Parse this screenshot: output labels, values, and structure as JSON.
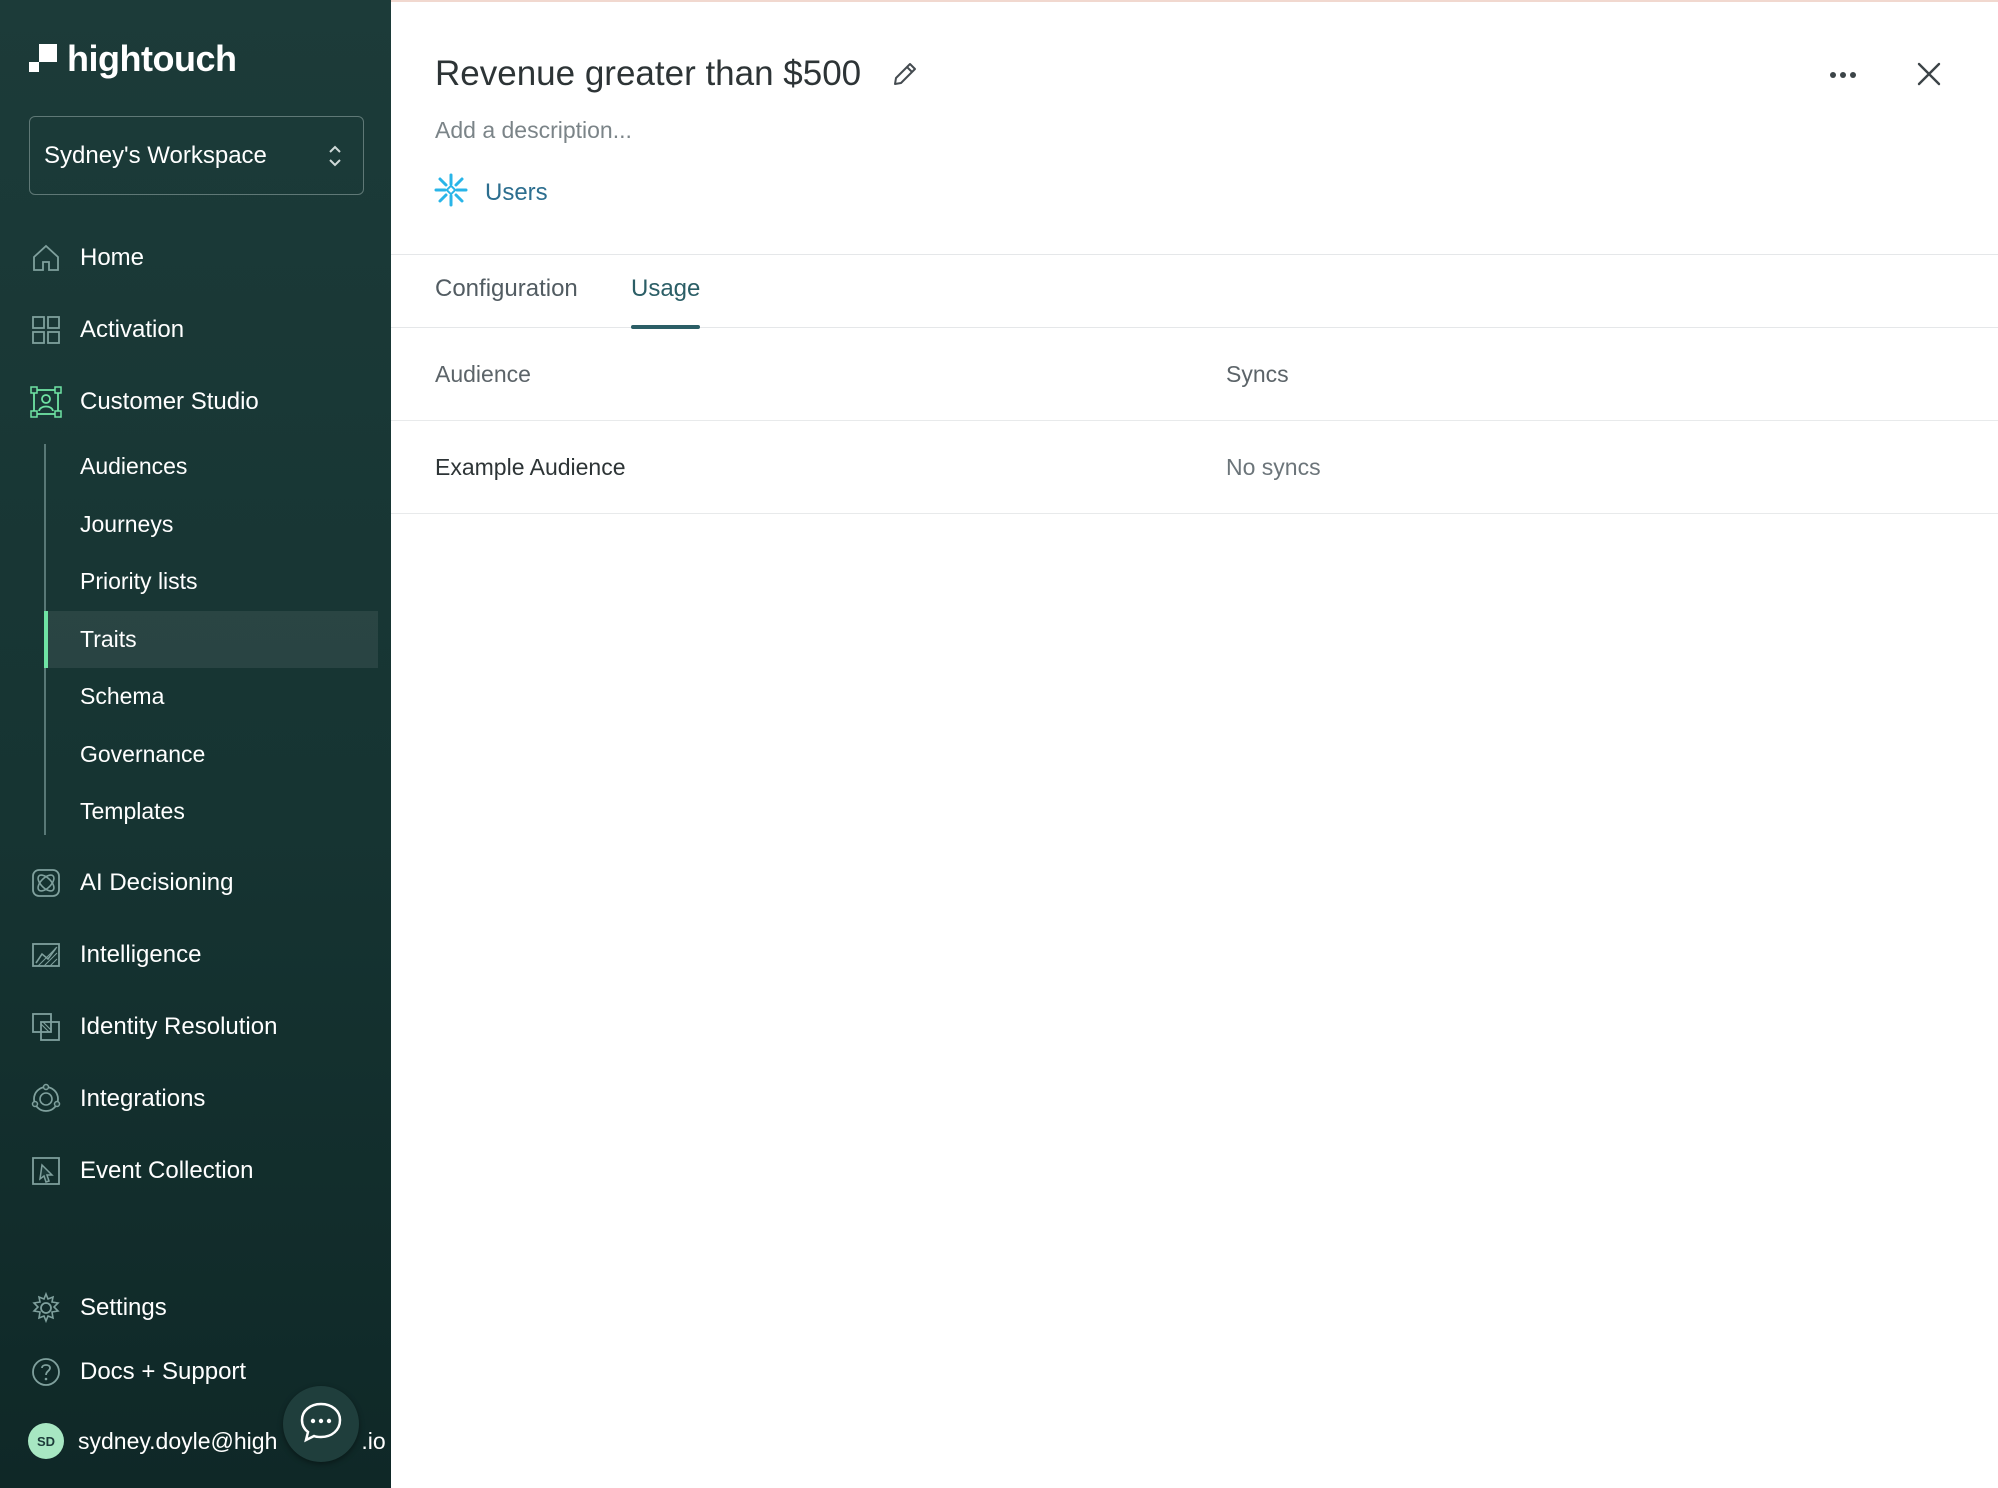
{
  "brand": {
    "name": "hightouch"
  },
  "workspace": {
    "name": "Sydney's Workspace"
  },
  "nav": {
    "home": "Home",
    "activation": "Activation",
    "customer_studio": "Customer Studio",
    "sub": [
      "Audiences",
      "Journeys",
      "Priority lists",
      "Traits",
      "Schema",
      "Governance",
      "Templates"
    ],
    "selected_sub": "Traits",
    "ai_decisioning": "AI Decisioning",
    "intelligence": "Intelligence",
    "identity_resolution": "Identity Resolution",
    "integrations": "Integrations",
    "event_collection": "Event Collection",
    "settings": "Settings",
    "docs_support": "Docs + Support"
  },
  "user": {
    "initials": "SD",
    "email": "sydney.doyle@hightouch.io",
    "email_visible": "sydney.doyle@high",
    "email_suffix": ".io"
  },
  "trait": {
    "title": "Revenue greater than $500",
    "description_placeholder": "Add a description...",
    "parent_model": "Users"
  },
  "tabs": {
    "configuration": "Configuration",
    "usage": "Usage",
    "active": "Usage"
  },
  "usage_table": {
    "columns": [
      "Audience",
      "Syncs"
    ],
    "rows": [
      {
        "audience": "Example Audience",
        "syncs": "No syncs"
      }
    ]
  },
  "icons": {
    "edit": "pencil-icon",
    "more": "more-horizontal-icon",
    "close": "close-icon",
    "model": "snowflake-icon",
    "chat": "chat-icon"
  },
  "colors": {
    "sidebar": "#1c3b39",
    "accent": "#2b5e66",
    "selected_marker": "#6fe3a4",
    "link": "#2c6e8f",
    "snowflake": "#29b5e8"
  }
}
